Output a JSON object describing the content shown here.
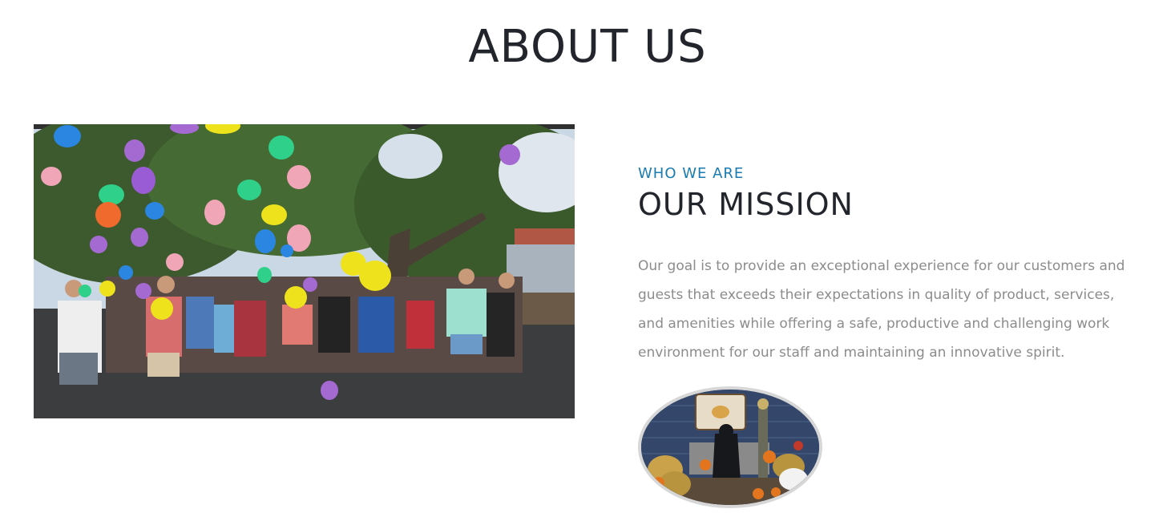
{
  "header": {
    "title": "ABOUT US"
  },
  "about": {
    "eyebrow": "WHO WE ARE",
    "title": "OUR MISSION",
    "body": "Our goal is to provide an exceptional experience for our customers and guests that exceeds their expectations in quality of product, services, and amenities while offering a safe, productive and challenging work environment for our staff and maintaining an innovative spirit."
  },
  "images": {
    "team_photo": "team-balloon-release-photo",
    "cafe_photo": "salty-dog-cafe-storefront-photo"
  },
  "colors": {
    "accent": "#1a7bb0",
    "heading": "#22252b",
    "body_text": "#8c8c8c",
    "background": "#ffffff"
  }
}
